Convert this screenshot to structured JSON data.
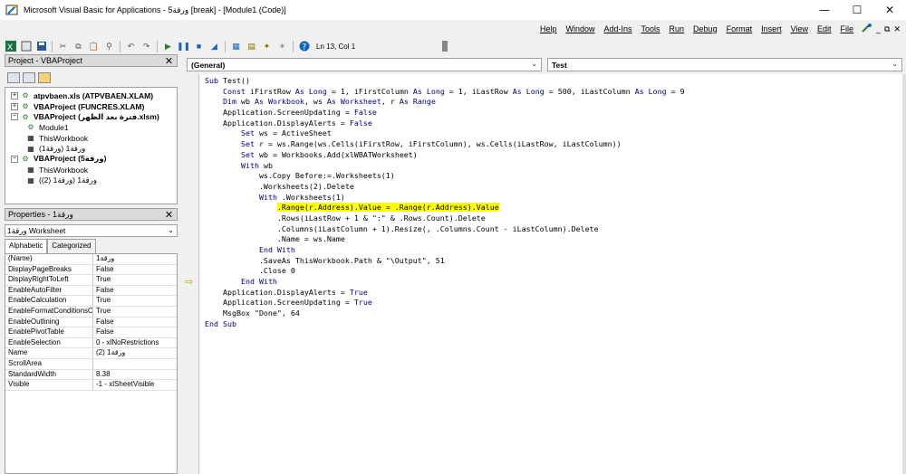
{
  "window": {
    "title": "Microsoft Visual Basic for Applications - ورقة5 [break] - [Module1 (Code)]",
    "minimize": "—",
    "maximize": "☐",
    "close": "✕"
  },
  "menu": {
    "items": [
      "Help",
      "Window",
      "Add-Ins",
      "Tools",
      "Run",
      "Debug",
      "Format",
      "Insert",
      "View",
      "Edit",
      "File"
    ],
    "restore": "⧉",
    "min": "_",
    "close": "✕"
  },
  "toolbar": {
    "status": "Ln 13, Col 1"
  },
  "project": {
    "title": "Project - VBAProject",
    "close": "✕",
    "tree": [
      {
        "label": "atpvbaen.xls (ATPVBAEN.XLAM)",
        "bold": true,
        "level": 0,
        "exp": "+"
      },
      {
        "label": "VBAProject (FUNCRES.XLAM)",
        "bold": true,
        "level": 0,
        "exp": "+"
      },
      {
        "label": "VBAProject (فترة بعد الظهر.xlsm)",
        "bold": true,
        "level": 0,
        "exp": "−"
      },
      {
        "label": "Module1",
        "bold": false,
        "level": 1,
        "exp": ""
      },
      {
        "label": "ThisWorkbook",
        "bold": false,
        "level": 1,
        "exp": ""
      },
      {
        "label": "ورقة1 (ورقة1)",
        "bold": false,
        "level": 1,
        "exp": ""
      },
      {
        "label": "VBAProject (ورقة5)",
        "bold": true,
        "level": 0,
        "exp": "−"
      },
      {
        "label": "ThisWorkbook",
        "bold": false,
        "level": 1,
        "exp": ""
      },
      {
        "label": "ورقة1 (ورقة1 (2))",
        "bold": false,
        "level": 1,
        "exp": ""
      }
    ]
  },
  "properties": {
    "title": "Properties - ورقة1",
    "close": "✕",
    "object": "ورقة1 Worksheet",
    "tabs": [
      "Alphabetic",
      "Categorized"
    ],
    "rows": [
      [
        "(Name)",
        "ورقة1"
      ],
      [
        "DisplayPageBreaks",
        "False"
      ],
      [
        "DisplayRightToLeft",
        "True"
      ],
      [
        "EnableAutoFilter",
        "False"
      ],
      [
        "EnableCalculation",
        "True"
      ],
      [
        "EnableFormatConditionsC",
        "True"
      ],
      [
        "EnableOutlining",
        "False"
      ],
      [
        "EnablePivotTable",
        "False"
      ],
      [
        "EnableSelection",
        "0 - xlNoRestrictions"
      ],
      [
        "Name",
        "ورقة1 (2)"
      ],
      [
        "ScrollArea",
        ""
      ],
      [
        "StandardWidth",
        "8.38"
      ],
      [
        "Visible",
        "-1 - xlSheetVisible"
      ]
    ]
  },
  "code": {
    "object_combo": "(General)",
    "proc_combo": "Test",
    "lines": [
      "Sub Test()",
      "    Const iFirstRow As Long = 1, iFirstColumn As Long = 1, iLastRow As Long = 500, iLastColumn As Long = 9",
      "    Dim wb As Workbook, ws As Worksheet, r As Range",
      "    Application.ScreenUpdating = False",
      "    Application.DisplayAlerts = False",
      "        Set ws = ActiveSheet",
      "        Set r = ws.Range(ws.Cells(iFirstRow, iFirstColumn), ws.Cells(iLastRow, iLastColumn))",
      "        Set wb = Workbooks.Add(xlWBATWorksheet)",
      "        With wb",
      "            ws.Copy Before:=.Worksheets(1)",
      "            .Worksheets(2).Delete",
      "            With .Worksheets(1)",
      "                .Range(r.Address).Value = .Range(r.Address).Value",
      "                .Rows(iLastRow + 1 & \":\" & .Rows.Count).Delete",
      "                .Columns(iLastColumn + 1).Resize(, .Columns.Count - iLastColumn).Delete",
      "                .Name = ws.Name",
      "            End With",
      "            .SaveAs ThisWorkbook.Path & \"\\Output\", 51",
      "            .Close 0",
      "        End With",
      "    Application.DisplayAlerts = True",
      "    Application.ScreenUpdating = True",
      "    MsgBox \"Done\", 64",
      "End Sub"
    ],
    "highlight_line": 12
  }
}
